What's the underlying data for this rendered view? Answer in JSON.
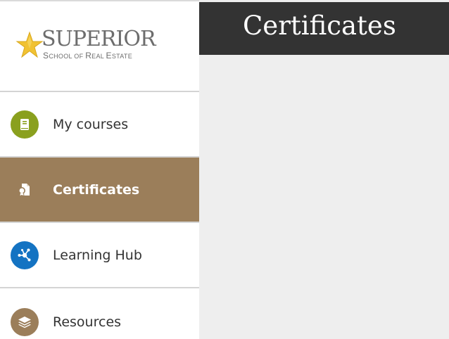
{
  "logo": {
    "word": "SUPERIOR",
    "subtitle": "School of Real Estate",
    "star_color": "#f1c232"
  },
  "sidebar": {
    "items": [
      {
        "label": "My courses",
        "icon": "book-icon",
        "icon_color": "#8aa01e",
        "active": false
      },
      {
        "label": "Certificates",
        "icon": "certificate-icon",
        "icon_color": "#9b7e5a",
        "active": true
      },
      {
        "label": "Learning Hub",
        "icon": "network-icon",
        "icon_color": "#1473c2",
        "active": false
      },
      {
        "label": "Resources",
        "icon": "layers-icon",
        "icon_color": "#9b7e5a",
        "active": false
      }
    ]
  },
  "header": {
    "title": "Certificates",
    "background": "#333333"
  },
  "colors": {
    "active_bg": "#9b7e5a",
    "content_bg": "#eeeeee"
  }
}
